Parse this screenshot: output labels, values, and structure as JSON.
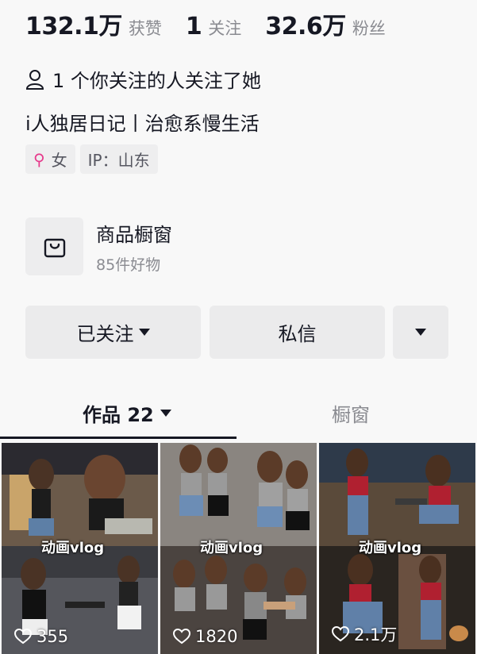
{
  "stats": {
    "likes_num": "132.1万",
    "likes_label": "获赞",
    "following_num": "1",
    "following_label": "关注",
    "fans_num": "32.6万",
    "fans_label": "粉丝"
  },
  "mutual": {
    "text": "1 个你关注的人关注了她"
  },
  "bio": "i人独居日记丨治愈系慢生活",
  "tags": {
    "gender": "女",
    "ip": "IP：山东"
  },
  "shop": {
    "title": "商品橱窗",
    "subtitle": "85件好物"
  },
  "buttons": {
    "follow": "已关注",
    "message": "私信"
  },
  "tabs": {
    "works": "作品 22",
    "window": "橱窗"
  },
  "videos": [
    {
      "overlay": "动画vlog",
      "likes": "355"
    },
    {
      "overlay": "动画vlog",
      "likes": "1820"
    },
    {
      "overlay": "动画vlog",
      "likes": "2.1万"
    }
  ],
  "colors": {
    "accent_gender": "#e63a8c",
    "button_bg": "#ebebec",
    "text_primary": "#161823",
    "text_secondary": "#8a8b91"
  }
}
